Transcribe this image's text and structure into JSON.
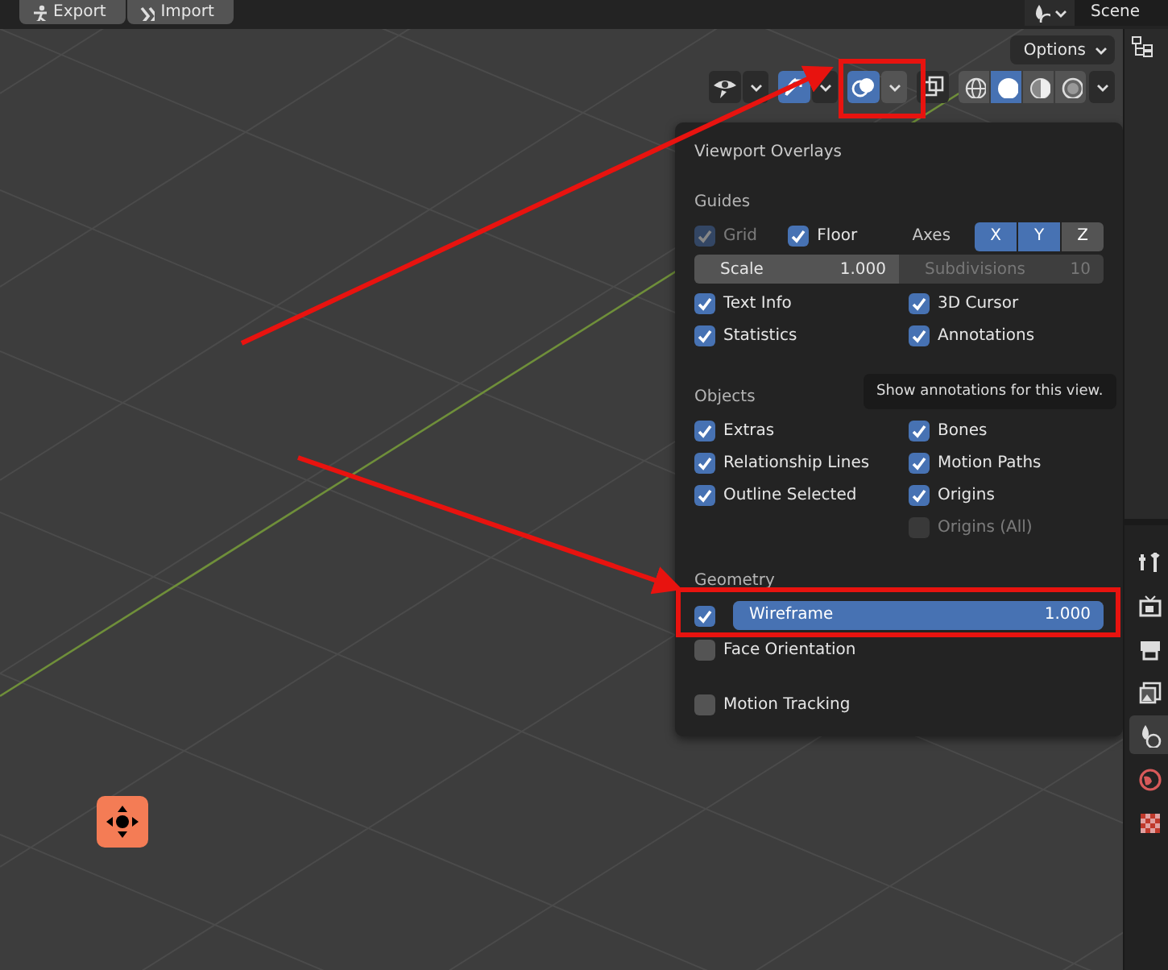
{
  "top_bar": {
    "buttons": [
      {
        "label": "Export",
        "kind": "figure"
      },
      {
        "label": "Import",
        "kind": "chevrons"
      }
    ],
    "scene": "Scene"
  },
  "viewport_header": {
    "options": "Options",
    "tools": [
      {
        "kind": "visibility",
        "selected": false
      },
      {
        "kind": "gizmo",
        "selected": true
      },
      {
        "kind": "overlay",
        "selected": true
      },
      {
        "kind": "xray",
        "selected": false
      }
    ],
    "shading": [
      {
        "kind": "wireframe",
        "selected": false
      },
      {
        "kind": "solid",
        "selected": true
      },
      {
        "kind": "material",
        "selected": false
      },
      {
        "kind": "rendered",
        "selected": false
      }
    ]
  },
  "overlays": {
    "title": "Viewport Overlays",
    "guides": {
      "heading": "Guides",
      "grid": {
        "label": "Grid",
        "checked": true,
        "disabled": true
      },
      "floor": {
        "label": "Floor",
        "checked": true,
        "disabled": false
      },
      "axes_label": "Axes",
      "axes": [
        {
          "label": "X",
          "selected": true
        },
        {
          "label": "Y",
          "selected": true
        },
        {
          "label": "Z",
          "selected": false
        }
      ],
      "scale": {
        "label": "Scale",
        "value": "1.000",
        "disabled": false
      },
      "subdivisions": {
        "label": "Subdivisions",
        "value": "10",
        "disabled": true
      },
      "columns": [
        [
          {
            "label": "Text Info",
            "checked": true,
            "disabled": false
          },
          {
            "label": "Statistics",
            "checked": true,
            "disabled": false
          }
        ],
        [
          {
            "label": "3D Cursor",
            "checked": true,
            "disabled": false
          },
          {
            "label": "Annotations",
            "checked": true,
            "disabled": false
          }
        ]
      ]
    },
    "objects": {
      "heading": "Objects",
      "columns": [
        [
          {
            "label": "Extras",
            "checked": true,
            "disabled": false
          },
          {
            "label": "Relationship Lines",
            "checked": true,
            "disabled": false
          },
          {
            "label": "Outline Selected",
            "checked": true,
            "disabled": false
          }
        ],
        [
          {
            "label": "Bones",
            "checked": true,
            "disabled": false
          },
          {
            "label": "Motion Paths",
            "checked": true,
            "disabled": false
          },
          {
            "label": "Origins",
            "checked": true,
            "disabled": false
          },
          {
            "label": "Origins (All)",
            "checked": false,
            "disabled": true
          }
        ]
      ]
    },
    "geometry": {
      "heading": "Geometry",
      "wireframe": {
        "label": "Wireframe",
        "checked": true,
        "level": 1,
        "value": "1.000"
      },
      "face_orientation": {
        "label": "Face Orientation",
        "checked": false,
        "disabled": false
      }
    },
    "motion_tracking": {
      "label": "Motion Tracking",
      "checked": false,
      "disabled": false
    }
  },
  "tooltip": "Show annotations for this view.",
  "properties_tabs": [
    {
      "kind": "tool",
      "selected": false
    },
    {
      "kind": "render",
      "selected": false
    },
    {
      "kind": "output",
      "selected": false
    },
    {
      "kind": "view-layer",
      "selected": false
    },
    {
      "kind": "scene",
      "selected": true
    },
    {
      "kind": "world",
      "selected": false
    },
    {
      "kind": "texture",
      "selected": false
    }
  ]
}
